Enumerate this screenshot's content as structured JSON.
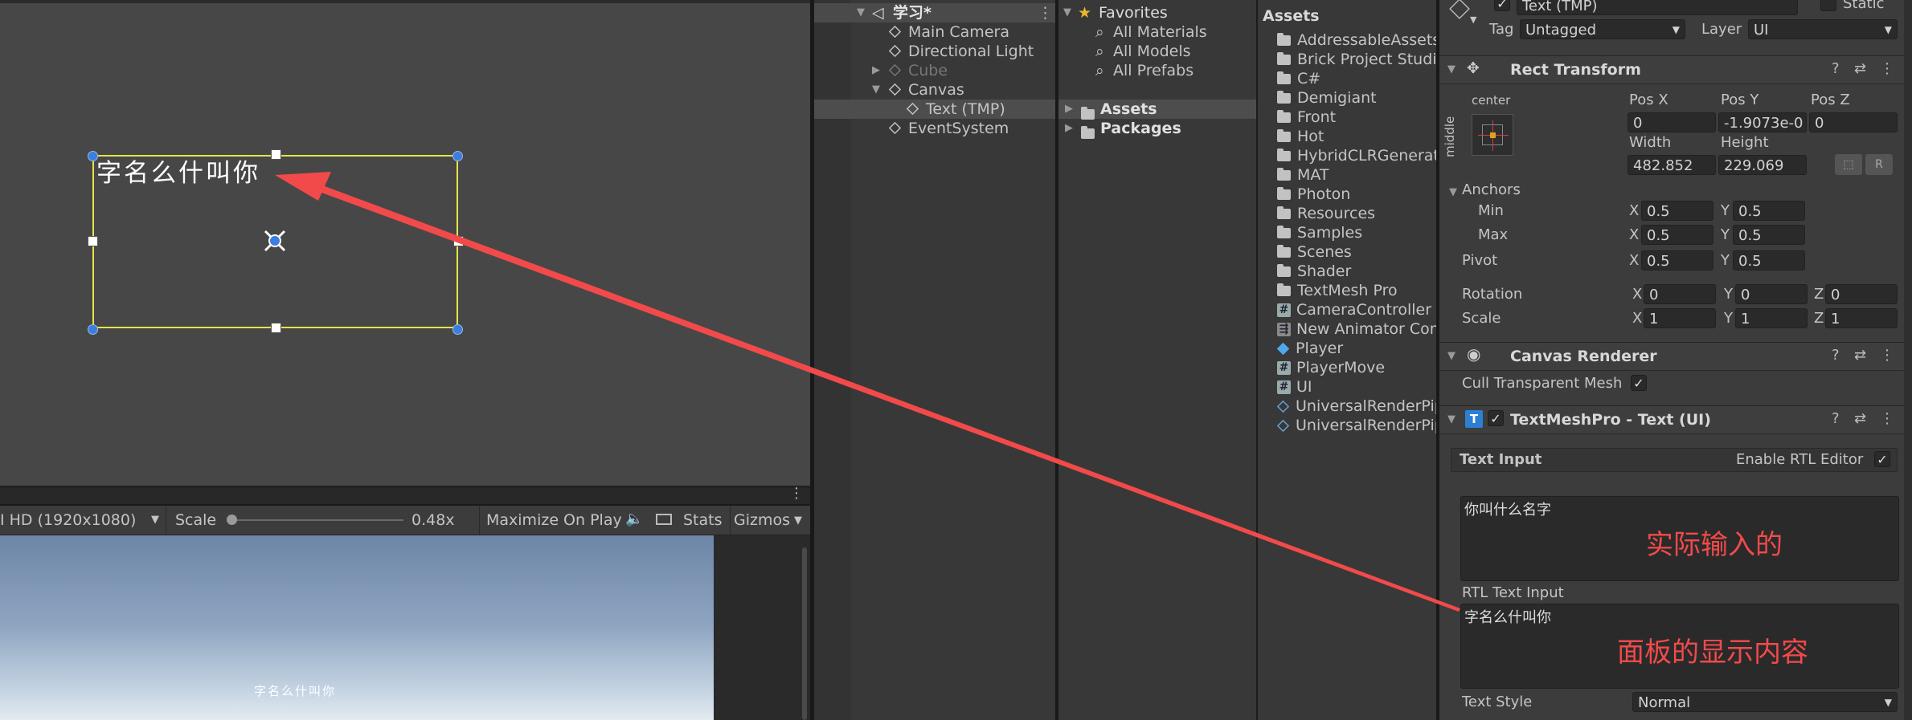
{
  "scene_view": {
    "ui_text": "字名么什叫你"
  },
  "game_view": {
    "resolution": "I HD (1920x1080)",
    "scale_label": "Scale",
    "scale_value": "0.48x",
    "maximize_on_play": "Maximize On Play",
    "stats": "Stats",
    "gizmos": "Gizmos",
    "rendered_text": "字名么什叫你"
  },
  "hierarchy": {
    "scene_name": "学习*",
    "items": [
      {
        "label": "Main Camera"
      },
      {
        "label": "Directional Light"
      },
      {
        "label": "Cube"
      },
      {
        "label": "Canvas"
      },
      {
        "label": "Text (TMP)"
      },
      {
        "label": "EventSystem"
      }
    ]
  },
  "project": {
    "favorites_label": "Favorites",
    "favorites": [
      "All Materials",
      "All Models",
      "All Prefabs"
    ],
    "roots": [
      "Assets",
      "Packages"
    ],
    "assets_header": "Assets",
    "assets": [
      {
        "label": "AddressableAssetsD",
        "kind": "folder"
      },
      {
        "label": "Brick Project Studio",
        "kind": "folder"
      },
      {
        "label": "C#",
        "kind": "folder"
      },
      {
        "label": "Demigiant",
        "kind": "folder"
      },
      {
        "label": "Front",
        "kind": "folder"
      },
      {
        "label": "Hot",
        "kind": "folder"
      },
      {
        "label": "HybridCLRGenerate",
        "kind": "folder"
      },
      {
        "label": "MAT",
        "kind": "folder"
      },
      {
        "label": "Photon",
        "kind": "folder"
      },
      {
        "label": "Resources",
        "kind": "folder"
      },
      {
        "label": "Samples",
        "kind": "folder"
      },
      {
        "label": "Scenes",
        "kind": "folder"
      },
      {
        "label": "Shader",
        "kind": "folder"
      },
      {
        "label": "TextMesh Pro",
        "kind": "folder"
      },
      {
        "label": "CameraController",
        "kind": "script"
      },
      {
        "label": "New Animator Contr",
        "kind": "animator"
      },
      {
        "label": "Player",
        "kind": "prefab"
      },
      {
        "label": "PlayerMove",
        "kind": "script"
      },
      {
        "label": "UI",
        "kind": "script"
      },
      {
        "label": "UniversalRenderPip",
        "kind": "asset"
      },
      {
        "label": "UniversalRenderPip",
        "kind": "asset"
      }
    ]
  },
  "inspector": {
    "object_name": "Text (TMP)",
    "static_label": "Static",
    "tag_label": "Tag",
    "tag_value": "Untagged",
    "layer_label": "Layer",
    "layer_value": "UI",
    "rect_transform": {
      "title": "Rect Transform",
      "anchor_h": "center",
      "anchor_v": "middle",
      "pos_x_label": "Pos X",
      "pos_x": "0",
      "pos_y_label": "Pos Y",
      "pos_y": "-1.9073e-0",
      "pos_z_label": "Pos Z",
      "pos_z": "0",
      "width_label": "Width",
      "width": "482.852",
      "height_label": "Height",
      "height": "229.069",
      "anchors_label": "Anchors",
      "min_label": "Min",
      "min_x": "0.5",
      "min_y": "0.5",
      "max_label": "Max",
      "max_x": "0.5",
      "max_y": "0.5",
      "pivot_label": "Pivot",
      "pivot_x": "0.5",
      "pivot_y": "0.5",
      "rotation_label": "Rotation",
      "rot_x": "0",
      "rot_y": "0",
      "rot_z": "0",
      "scale_label": "Scale",
      "scale_x": "1",
      "scale_y": "1",
      "scale_z": "1",
      "x": "X",
      "y": "Y",
      "z": "Z",
      "r_button": "R"
    },
    "canvas_renderer": {
      "title": "Canvas Renderer",
      "cull_label": "Cull Transparent Mesh"
    },
    "tmp": {
      "title": "TextMeshPro - Text (UI)",
      "text_input_label": "Text Input",
      "rtl_editor_label": "Enable RTL Editor",
      "input_text": "你叫什么名字",
      "input_annotation": "实际输入的",
      "rtl_label": "RTL Text Input",
      "rtl_text": "字名么什叫你",
      "rtl_annotation": "面板的显示内容",
      "text_style_label": "Text Style",
      "text_style_value": "Normal"
    }
  },
  "colors": {
    "annotation_red": "#f24a4a",
    "selection_yellow": "#e6e24a"
  }
}
